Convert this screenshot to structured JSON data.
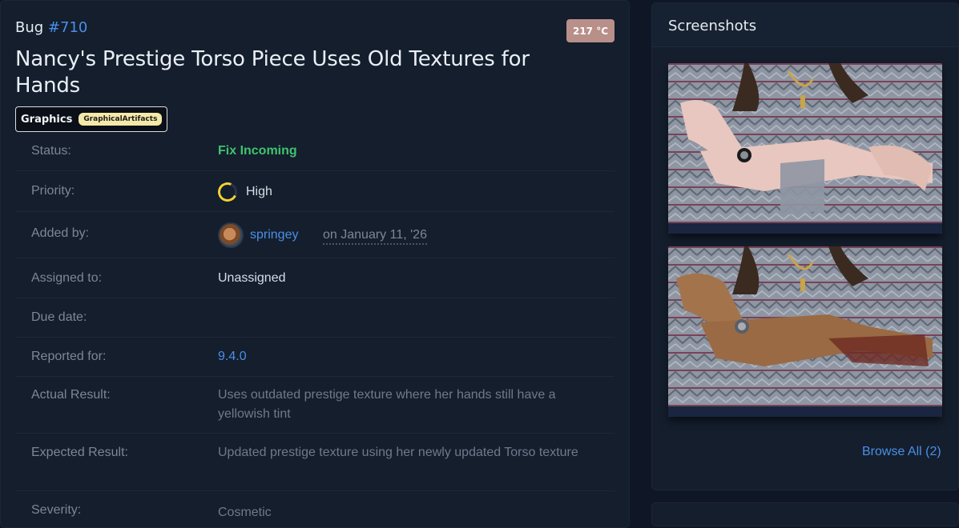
{
  "bug": {
    "prefix": "Bug",
    "number": "#710",
    "temperature": "217 °C",
    "title": "Nancy's Prestige Torso Piece Uses Old Textures for Hands",
    "category": "Graphics",
    "subcategory": "GraphicalArtifacts"
  },
  "fields": {
    "status": {
      "label": "Status:",
      "value": "Fix Incoming"
    },
    "priority": {
      "label": "Priority:",
      "value": "High"
    },
    "added_by": {
      "label": "Added by:",
      "user": "springey",
      "date": "on January 11, '26"
    },
    "assigned_to": {
      "label": "Assigned to:",
      "value": "Unassigned"
    },
    "due_date": {
      "label": "Due date:",
      "value": ""
    },
    "reported_for": {
      "label": "Reported for:",
      "value": "9.4.0"
    },
    "actual_result": {
      "label": "Actual Result:",
      "value": "Uses outdated prestige texture where her hands still have a yellowish tint"
    },
    "expected_result": {
      "label": "Expected Result:",
      "value": "Updated prestige texture using her newly updated Torso texture"
    },
    "severity": {
      "label": "Severity:",
      "value": "Cosmetic"
    }
  },
  "sidebar": {
    "title": "Screenshots",
    "browse_all": "Browse All (2)"
  },
  "colors": {
    "accent": "#4a8fe8",
    "status_green": "#3ec46d",
    "priority_yellow": "#f0d230",
    "badge": "#b98f8a"
  }
}
